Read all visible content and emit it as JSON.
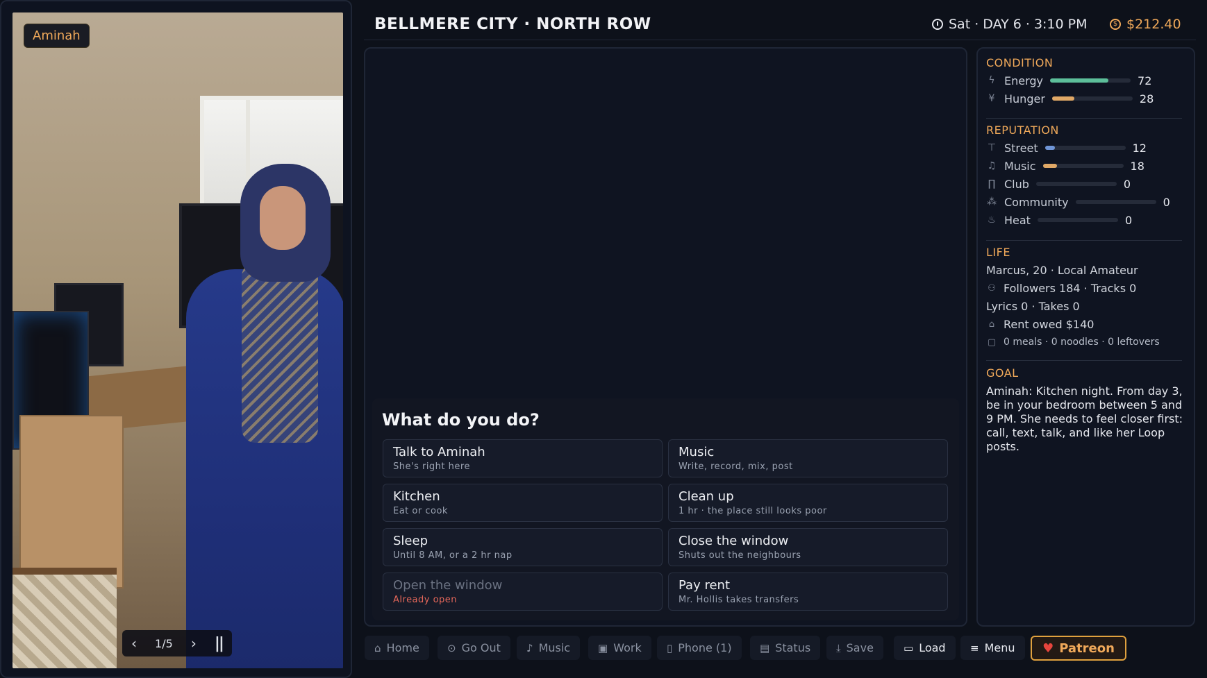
{
  "character": {
    "name_tag": "Aminah",
    "gallery": {
      "counter": "1/5",
      "prev": "‹",
      "next": "›",
      "pause": "||"
    }
  },
  "header": {
    "location": "BELLMERE CITY · NORTH ROW",
    "time": "Sat · DAY 6 · 3:10 PM",
    "money": "$212.40"
  },
  "choices": {
    "title": "What do you do?",
    "items": [
      {
        "label": "Talk to Aminah",
        "sub": "She's right here",
        "enabled": true
      },
      {
        "label": "Music",
        "sub": "Write, record, mix, post",
        "enabled": true
      },
      {
        "label": "Kitchen",
        "sub": "Eat or cook",
        "enabled": true
      },
      {
        "label": "Clean up",
        "sub": "1 hr · the place still looks poor",
        "enabled": true
      },
      {
        "label": "Sleep",
        "sub": "Until 8 AM, or a 2 hr nap",
        "enabled": true
      },
      {
        "label": "Close the window",
        "sub": "Shuts out the neighbours",
        "enabled": true
      },
      {
        "label": "Open the window",
        "sub": "Already open",
        "enabled": false
      },
      {
        "label": "Pay rent",
        "sub": "Mr. Hollis takes transfers",
        "enabled": true
      }
    ]
  },
  "status": {
    "condition": {
      "title": "CONDITION",
      "stats": [
        {
          "name": "Energy",
          "value": 72,
          "max": 100,
          "color": "#5dbf9a",
          "icon": "lightning-icon"
        },
        {
          "name": "Hunger",
          "value": 28,
          "max": 100,
          "color": "#e0a866",
          "icon": "fork-knife-icon"
        }
      ]
    },
    "reputation": {
      "title": "REPUTATION",
      "stats": [
        {
          "name": "Street",
          "value": 12,
          "max": 100,
          "color": "#6f95d6",
          "icon": "signpost-icon"
        },
        {
          "name": "Music",
          "value": 18,
          "max": 100,
          "color": "#e0a866",
          "icon": "music-note-icon"
        },
        {
          "name": "Club",
          "value": 0,
          "max": 100,
          "color": "#6f95d6",
          "icon": "glass-icon"
        },
        {
          "name": "Community",
          "value": 0,
          "max": 100,
          "color": "#6f95d6",
          "icon": "people-icon"
        },
        {
          "name": "Heat",
          "value": 0,
          "max": 100,
          "color": "#e5675a",
          "icon": "flame-icon"
        }
      ]
    },
    "life": {
      "title": "LIFE",
      "identity": "Marcus, 20 · Local Amateur",
      "followers": "Followers 184 · Tracks 0",
      "lyrics": "Lyrics 0 · Takes 0",
      "rent": "Rent owed $140",
      "food": "0 meals · 0 noodles · 0 leftovers"
    },
    "goal": {
      "title": "GOAL",
      "text": "Aminah: Kitchen night. From day 3, be in your bedroom between 5 and 9 PM. She needs to feel closer first: call, text, talk, and like her Loop posts."
    }
  },
  "nav": {
    "items": [
      {
        "label": "Home",
        "icon": "home-icon"
      },
      {
        "label": "Go Out",
        "icon": "map-pin-icon"
      },
      {
        "label": "Music",
        "icon": "microphone-icon"
      },
      {
        "label": "Work",
        "icon": "briefcase-icon"
      },
      {
        "label": "Phone (1)",
        "icon": "phone-icon"
      },
      {
        "label": "Status",
        "icon": "id-card-icon"
      },
      {
        "label": "Save",
        "icon": "download-icon"
      },
      {
        "label": "Load",
        "icon": "folder-icon"
      },
      {
        "label": "Menu",
        "icon": "hamburger-icon"
      }
    ],
    "patreon": "Patreon"
  }
}
